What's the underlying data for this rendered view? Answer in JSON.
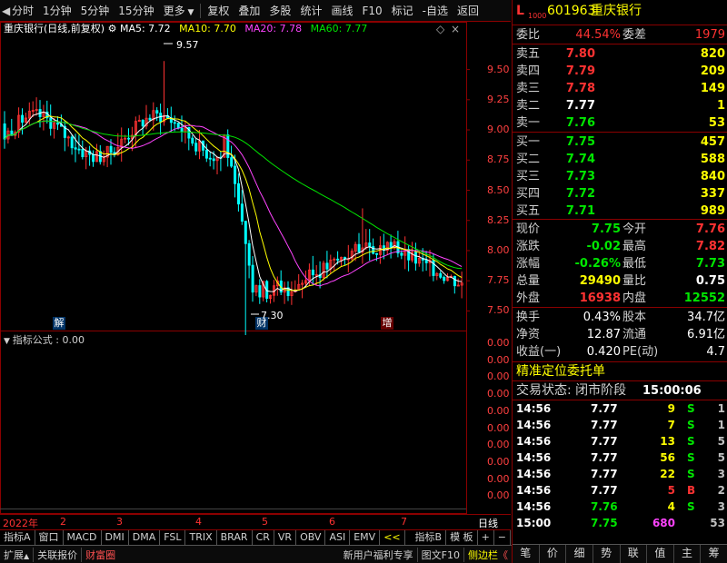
{
  "toolbar": {
    "items": [
      "分时",
      "1分钟",
      "5分钟",
      "15分钟",
      "更多",
      "复权",
      "叠加",
      "多股",
      "统计",
      "画线",
      "F10",
      "标记",
      "-自选",
      "返回"
    ]
  },
  "chart": {
    "stock_title": "重庆银行(日线,前复权)",
    "ma5": "MA5: 7.72",
    "ma10": "MA10: 7.70",
    "ma20": "MA20: 7.78",
    "ma60": "MA60: 7.77",
    "high_mark": "9.57",
    "low_mark": "7.30",
    "y_labels": [
      "9.50",
      "9.25",
      "9.00",
      "8.75",
      "8.50",
      "8.25",
      "8.00",
      "7.75",
      "7.50"
    ],
    "events": [
      "解",
      "财",
      "增"
    ],
    "colors": {
      "up": "#ff3232",
      "down": "#00ffff",
      "ma5": "#ffffff",
      "ma10": "#ffff00",
      "ma20": "#ff44ff",
      "ma60": "#00e600"
    }
  },
  "indicator": {
    "label": "指标公式 : 0.00",
    "y_labels": [
      "0.00",
      "0.00",
      "0.00",
      "0.00",
      "0.00",
      "0.00",
      "0.00",
      "0.00",
      "0.00",
      "0.00"
    ]
  },
  "x_axis": {
    "labels": [
      "2022年",
      "2",
      "3",
      "4",
      "5",
      "6",
      "7"
    ],
    "period": "日线"
  },
  "tabs": [
    "指标A",
    "窗口",
    "MACD",
    "DMI",
    "DMA",
    "FSL",
    "TRIX",
    "BRAR",
    "CR",
    "VR",
    "OBV",
    "ASI",
    "EMV",
    "<<"
  ],
  "tabs_right": [
    "指标B",
    "模 板",
    "+",
    "−"
  ],
  "status_bar": {
    "left": [
      "扩展",
      "关联报价",
      "财富圈"
    ],
    "right": [
      "新用户福利专享",
      "图文F10",
      "侧边栏"
    ]
  },
  "quote": {
    "code": "601963",
    "name": "重庆银行",
    "l_mark": "L",
    "level_mark": "1000",
    "webi_label": "委比",
    "webi_value": "44.54%",
    "weicha_label": "委差",
    "weicha_value": "1979",
    "sells": [
      {
        "label": "卖五",
        "price": "7.80",
        "vol": "820"
      },
      {
        "label": "卖四",
        "price": "7.79",
        "vol": "209"
      },
      {
        "label": "卖三",
        "price": "7.78",
        "vol": "149"
      },
      {
        "label": "卖二",
        "price": "7.77",
        "vol": "1"
      },
      {
        "label": "卖一",
        "price": "7.76",
        "vol": "53"
      }
    ],
    "buys": [
      {
        "label": "买一",
        "price": "7.75",
        "vol": "457"
      },
      {
        "label": "买二",
        "price": "7.74",
        "vol": "588"
      },
      {
        "label": "买三",
        "price": "7.73",
        "vol": "840"
      },
      {
        "label": "买四",
        "price": "7.72",
        "vol": "337"
      },
      {
        "label": "买五",
        "price": "7.71",
        "vol": "989"
      }
    ],
    "stats": [
      {
        "l1": "现价",
        "v1": "7.75",
        "l2": "今开",
        "v2": "7.76"
      },
      {
        "l1": "涨跌",
        "v1": "-0.02",
        "l2": "最高",
        "v2": "7.82"
      },
      {
        "l1": "涨幅",
        "v1": "-0.26%",
        "l2": "最低",
        "v2": "7.73"
      },
      {
        "l1": "总量",
        "v1": "29490",
        "l2": "量比",
        "v2": "0.75"
      },
      {
        "l1": "外盘",
        "v1": "16938",
        "l2": "内盘",
        "v2": "12552"
      }
    ],
    "stats2": [
      {
        "l1": "换手",
        "v1": "0.43%",
        "l2": "股本",
        "v2": "34.7亿"
      },
      {
        "l1": "净资",
        "v1": "12.87",
        "l2": "流通",
        "v2": "6.91亿"
      },
      {
        "l1": "收益(一)",
        "v1": "0.420",
        "l2": "PE(动)",
        "v2": "4.7"
      }
    ],
    "precise_order": "精准定位委托单",
    "trade_status_label": "交易状态: 闭市阶段",
    "trade_status_time": "15:00:06"
  },
  "ticks": [
    {
      "time": "14:56",
      "price": "7.77",
      "vol": "9",
      "dir": "S",
      "n": "1"
    },
    {
      "time": "14:56",
      "price": "7.77",
      "vol": "7",
      "dir": "S",
      "n": "1"
    },
    {
      "time": "14:56",
      "price": "7.77",
      "vol": "13",
      "dir": "S",
      "n": "5"
    },
    {
      "time": "14:56",
      "price": "7.77",
      "vol": "56",
      "dir": "S",
      "n": "5"
    },
    {
      "time": "14:56",
      "price": "7.77",
      "vol": "22",
      "dir": "S",
      "n": "3"
    },
    {
      "time": "14:56",
      "price": "7.77",
      "vol": "5",
      "dir": "B",
      "n": "2"
    },
    {
      "time": "14:56",
      "price": "7.76",
      "vol": "4",
      "dir": "S",
      "n": "3"
    },
    {
      "time": "15:00",
      "price": "7.75",
      "vol": "680",
      "dir": "",
      "n": "53"
    }
  ],
  "right_tabs": [
    "笔",
    "价",
    "细",
    "势",
    "联",
    "值",
    "主",
    "筹"
  ]
}
